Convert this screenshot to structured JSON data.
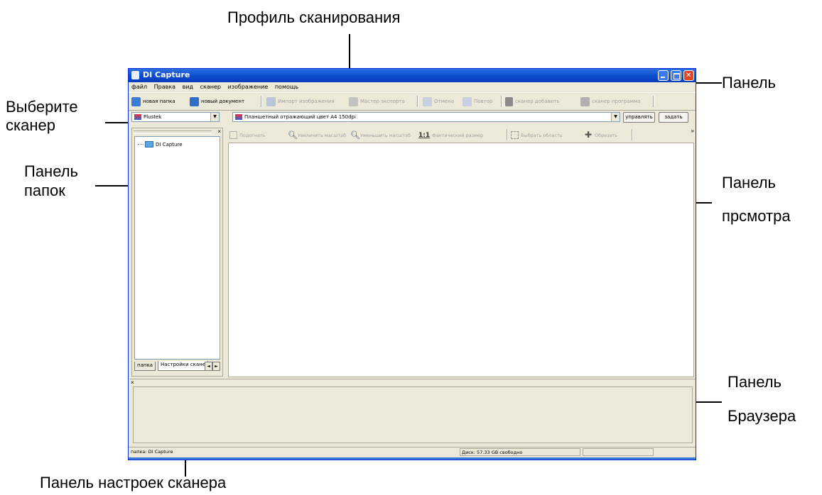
{
  "annotations": {
    "scan_profile": "Профиль сканирования",
    "panel": "Панель",
    "select_scanner_1": "Выберите",
    "select_scanner_2": "сканер",
    "folder_panel_1": "Панель",
    "folder_panel_2": "папок",
    "view_panel_1": "Панель",
    "view_panel_2": "прсмотра",
    "browser_panel_1": "Панель",
    "browser_panel_2": "Браузера",
    "scanner_settings_panel": "Панель настроек сканера"
  },
  "window": {
    "title": "DI Capture",
    "title_color": "#0a4bd0"
  },
  "menu": [
    "файл",
    "Правка",
    "вид",
    "сканер",
    "изображение",
    "помощь"
  ],
  "toolbar": {
    "new_folder": "новая папка",
    "new_document": "новый документ",
    "import_images": "Импорт изображения",
    "export_wizard": "Мастер экспорта",
    "undo": "Отмена",
    "redo": "Повтор",
    "add_scanner": "сканер добавить",
    "scanner_program": "сканер программа"
  },
  "scanner": {
    "selected": "Plustek",
    "profile": "Планшетный отражающий цвет A4 150dpi",
    "manage_button": "управлять",
    "set_button": "задать"
  },
  "folder_panel": {
    "root_node": "DI Capture",
    "tabs": [
      "папка",
      "Настройки скане"
    ]
  },
  "view_toolbar": {
    "fit": "Подогнать",
    "zoom_in": "Увеличить масштаб",
    "zoom_out": "Уменьшить масштаб",
    "actual_size_icon": "1:1",
    "actual_size": "Фактический размер",
    "select_area": "Выбрать область",
    "crop": "Обрезать"
  },
  "status": {
    "folder": "папка: DI Capture",
    "disk": "Диск: 57.33 GB свободно"
  }
}
